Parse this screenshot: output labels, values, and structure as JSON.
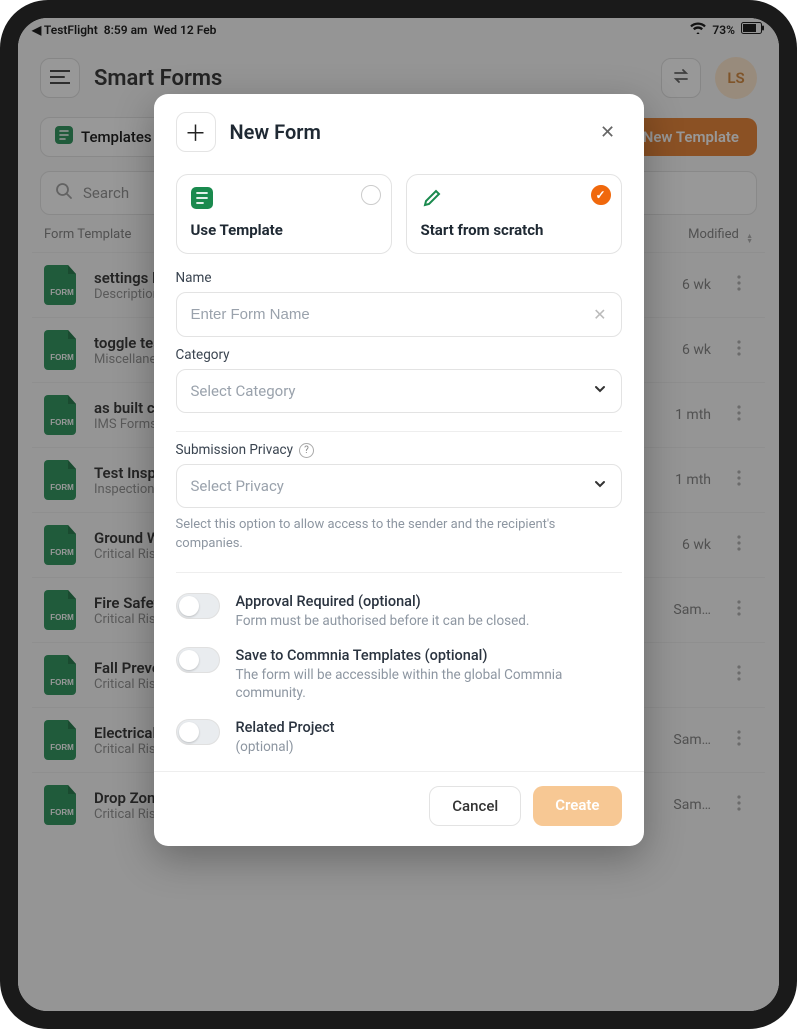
{
  "status": {
    "back_app": "◀ TestFlight",
    "time": "8:59 am",
    "date": "Wed 12 Feb",
    "battery": "73%"
  },
  "header": {
    "title": "Smart Forms",
    "avatar": "LS"
  },
  "toolbar": {
    "templates_label": "Templates",
    "new_template_label": "New Template"
  },
  "search": {
    "placeholder": "Search"
  },
  "list_header": {
    "col1": "Form Template",
    "col2": "Modified"
  },
  "rows": [
    {
      "title": "settings layout test",
      "sub": "Description text",
      "trail": "6 wk"
    },
    {
      "title": "toggle test form",
      "sub": "Miscellaneous",
      "trail": "6 wk"
    },
    {
      "title": "as built checklist",
      "sub": "IMS Forms",
      "trail": "1 mth"
    },
    {
      "title": "Test Inspection Form ITP",
      "sub": "Inspections",
      "trail": "1 mth"
    },
    {
      "title": "Ground Works Safety Review",
      "sub": "Critical Risk Program",
      "trail": "6 wk"
    },
    {
      "title": "Fire Safety Inspection Report",
      "sub": "Critical Risk Program",
      "trail": "Sam…"
    },
    {
      "title": "Fall Prevention Audit",
      "sub": "Critical Risk Program",
      "trail": ""
    },
    {
      "title": "Electrical Safety Audit Program",
      "sub": "Critical Risk Program",
      "trail": "Sam…"
    },
    {
      "title": "Drop Zone Risk Assessment",
      "sub": "Critical Risk Program",
      "trail": "Sam…"
    }
  ],
  "modal": {
    "title": "New Form",
    "option_template": "Use Template",
    "option_scratch": "Start from scratch",
    "name_label": "Name",
    "name_placeholder": "Enter Form Name",
    "category_label": "Category",
    "category_placeholder": "Select Category",
    "privacy_label": "Submission Privacy",
    "privacy_placeholder": "Select Privacy",
    "privacy_help": "Select this option to allow access to the sender and the recipient's companies.",
    "toggles": [
      {
        "title": "Approval Required (optional)",
        "desc": "Form must be authorised before it can be closed."
      },
      {
        "title": "Save to Commnia Templates (optional)",
        "desc": "The form will be accessible within the global Commnia community."
      },
      {
        "title": "Related Project",
        "desc": "(optional)"
      }
    ],
    "cancel": "Cancel",
    "create": "Create"
  },
  "colors": {
    "accent_orange": "#e67722",
    "form_green": "#1a8a4e"
  }
}
